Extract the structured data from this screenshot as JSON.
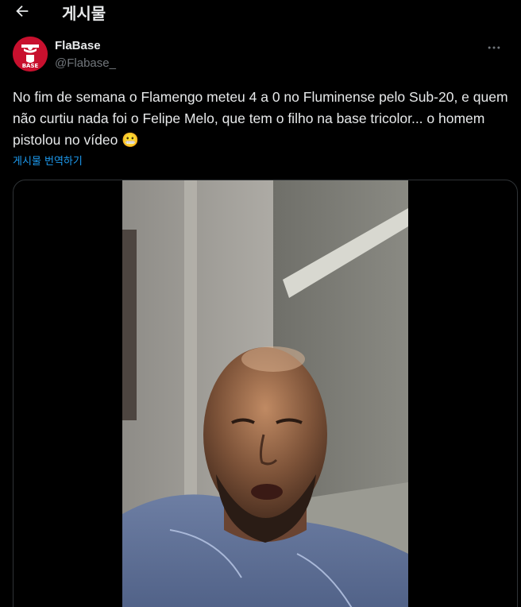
{
  "header": {
    "back_icon": "arrow-left-icon",
    "title": "게시물"
  },
  "tweet": {
    "author": {
      "display_name": "FlaBase",
      "handle": "@Flabase_",
      "avatar_text": "FLA BASE",
      "avatar_color": "#c8102e"
    },
    "text": "No fim de semana o Flamengo meteu 4 a 0 no Fluminense pelo Sub-20, e quem não curtiu nada foi o Felipe Melo, que tem o filho na base tricolor... o homem pistolou no vídeo 😬",
    "translate_label": "게시물 번역하기",
    "more_icon": "more-horizontal-icon",
    "media": {
      "type": "video",
      "subject": "man-selfie-video"
    }
  },
  "colors": {
    "background": "#000000",
    "text": "#e7e9ea",
    "muted": "#71767b",
    "link": "#1d9bf0",
    "border": "#2f3336"
  }
}
